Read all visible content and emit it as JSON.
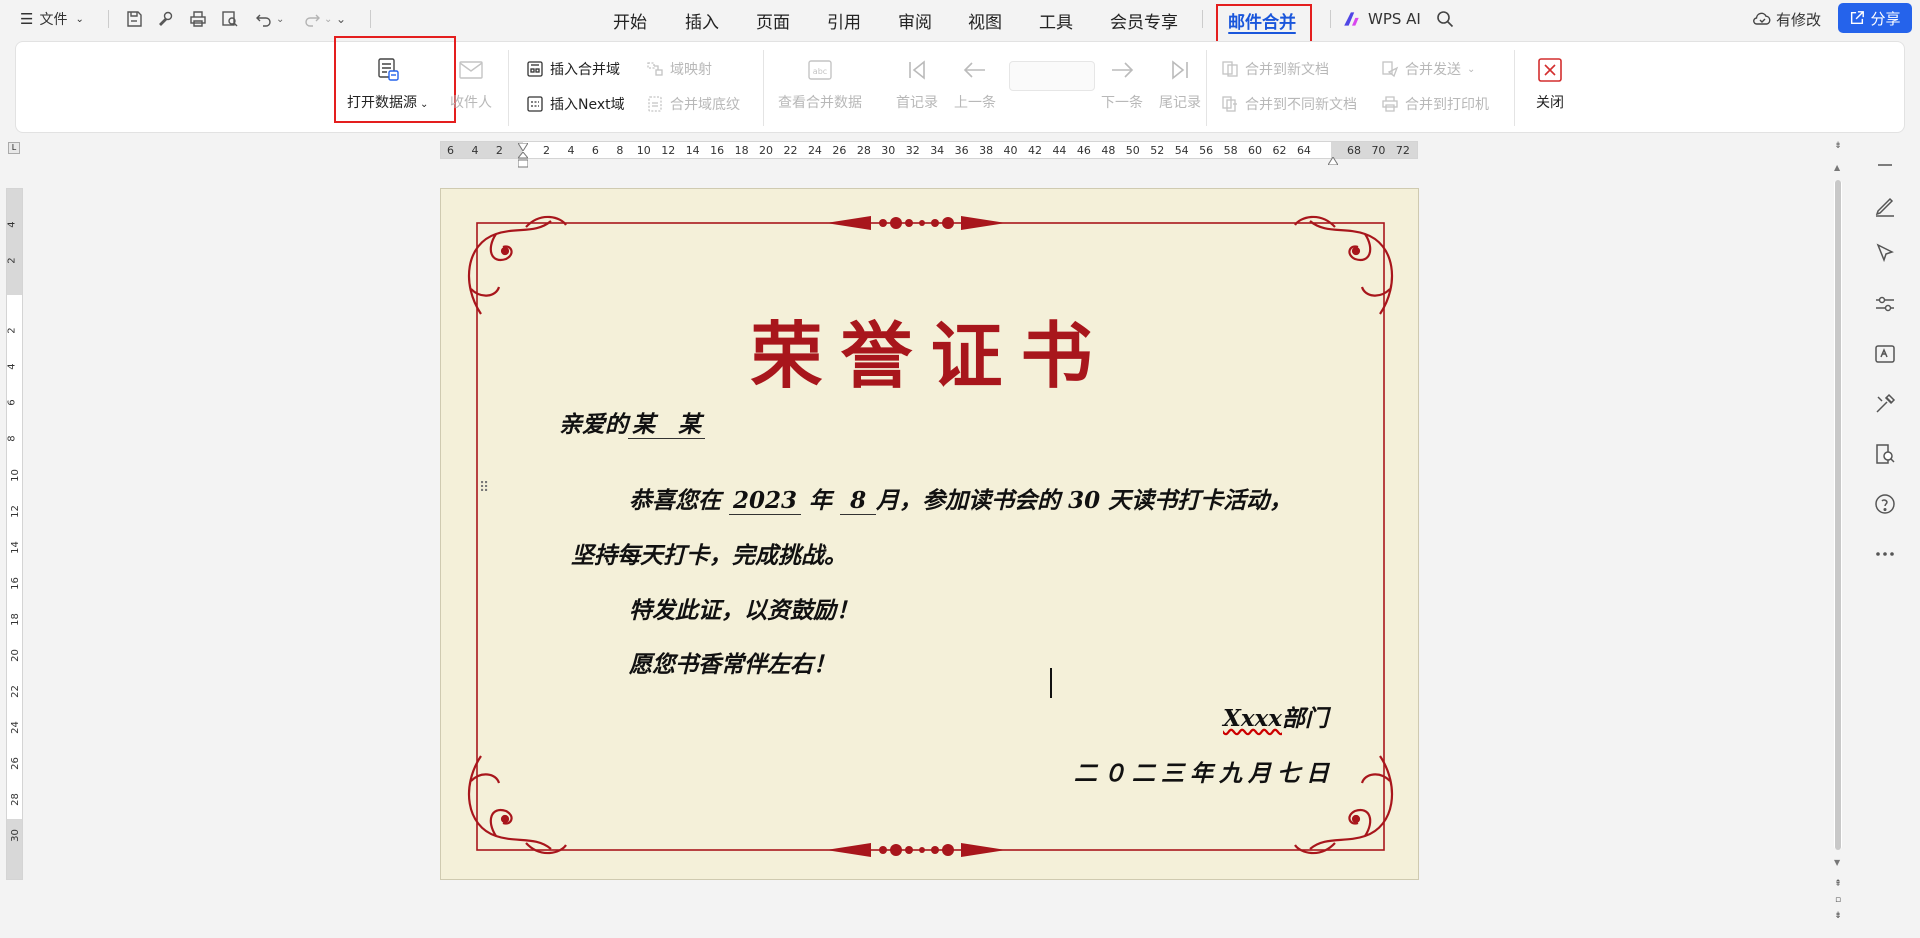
{
  "menu": {
    "file_label": "文件",
    "tabs": [
      "开始",
      "插入",
      "页面",
      "引用",
      "审阅",
      "视图",
      "工具",
      "会员专享",
      "邮件合并"
    ],
    "active_tab": "邮件合并",
    "wps_ai": "WPS AI",
    "modified": "有修改",
    "share": "分享"
  },
  "ribbon": {
    "open_datasource": "打开数据源",
    "recipients": "收件人",
    "insert_merge_field": "插入合并域",
    "field_mapping": "域映射",
    "insert_next": "插入Next域",
    "merge_field_shading": "合并域底纹",
    "view_merged_data": "查看合并数据",
    "first_record": "首记录",
    "prev_record": "上一条",
    "next_record": "下一条",
    "last_record": "尾记录",
    "merge_to_new_doc": "合并到新文档",
    "merge_to_diff_docs": "合并到不同新文档",
    "merge_send": "合并发送",
    "merge_to_printer": "合并到打印机",
    "close": "关闭"
  },
  "ruler": {
    "h_left_ticks": [
      "6",
      "4",
      "2"
    ],
    "h_ticks": [
      "2",
      "4",
      "6",
      "8",
      "10",
      "12",
      "14",
      "16",
      "18",
      "20",
      "22",
      "24",
      "26",
      "28",
      "30",
      "32",
      "34",
      "36",
      "38",
      "40",
      "42",
      "44",
      "46",
      "48",
      "50",
      "52",
      "54",
      "56",
      "58",
      "60",
      "62",
      "64"
    ],
    "h_right_ticks": [
      "68",
      "70",
      "72"
    ],
    "v_ticks": [
      "4",
      "2",
      "2",
      "4",
      "6",
      "8",
      "10",
      "12",
      "14",
      "16",
      "18",
      "20",
      "22",
      "24",
      "26",
      "28",
      "30"
    ]
  },
  "certificate": {
    "title": "荣誉证书",
    "salutation_prefix": "亲爱的",
    "recipient_name": "某　某",
    "line1_a": "恭喜您在",
    "year": "2023",
    "line1_b": "年",
    "month": "8",
    "line1_c": "月，参加读书会的 30 天读书打卡活动，",
    "line2": "坚持每天打卡，完成挑战。",
    "line3": "特发此证，以资鼓励！",
    "line4": "愿您书香常伴左右！",
    "department_name": "Xxxx",
    "department_suffix": "部门",
    "date": "二０二三年九月七日"
  },
  "colors": {
    "accent_blue": "#1a56db",
    "highlight_red": "#e41e1e",
    "certificate_red": "#a8161c",
    "page_bg": "#f4f0d9"
  }
}
